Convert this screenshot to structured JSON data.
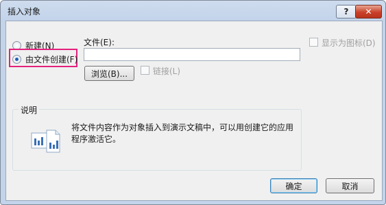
{
  "window": {
    "title": "插入对象",
    "help_label": "?",
    "close_label": "✕"
  },
  "options": {
    "new_label": "新建(N)",
    "from_file_label": "由文件创建(F)",
    "selected": "from_file"
  },
  "file": {
    "label": "文件(E):",
    "value": ""
  },
  "browse_label": "浏览(B)...",
  "link_label": "链接(L)",
  "display_as_icon_label": "显示为图标(D)",
  "description": {
    "title": "说明",
    "text": "将文件内容作为对象插入到演示文稿中，可以用创建它的应用程序激活它。"
  },
  "footer": {
    "ok_label": "确定",
    "cancel_label": "取消"
  },
  "colors": {
    "highlight": "#e3207d",
    "title_bg": "#c2d3ea",
    "close_bg": "#c9412a"
  }
}
